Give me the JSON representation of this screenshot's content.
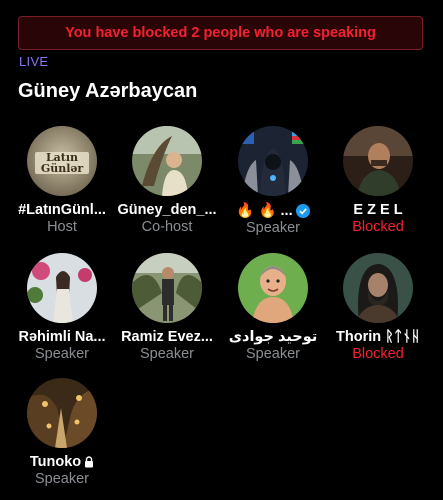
{
  "banner": {
    "text": "You have blocked 2 people who are speaking"
  },
  "space": {
    "live_label": "LIVE",
    "title": "Güney Azərbaycan"
  },
  "participants": [
    {
      "name": "#LatınGünl...",
      "role": "Host",
      "blocked": false,
      "avatar_text": "Latın Günlər"
    },
    {
      "name": "Güney_den_...",
      "role": "Co-host",
      "blocked": false
    },
    {
      "name": "🔥 🔥 ...",
      "role": "Speaker",
      "blocked": false,
      "verified": true
    },
    {
      "name": "E Z E L",
      "role": "Blocked",
      "blocked": true
    },
    {
      "name": "Rəhimli Na...",
      "role": "Speaker",
      "blocked": false
    },
    {
      "name": "Ramiz Evez...",
      "role": "Speaker",
      "blocked": false
    },
    {
      "name": "توحید جوادی",
      "role": "Speaker",
      "blocked": false
    },
    {
      "name": "Thorin ᚱᛏᚾᚺ",
      "role": "Blocked",
      "blocked": true
    },
    {
      "name": "Tunoko",
      "role": "Speaker",
      "blocked": false,
      "locked": true
    }
  ],
  "colors": {
    "accent": "#8b75f5",
    "blocked": "#f4212e",
    "verified": "#1d9bf0",
    "muted": "#8b8f94"
  }
}
